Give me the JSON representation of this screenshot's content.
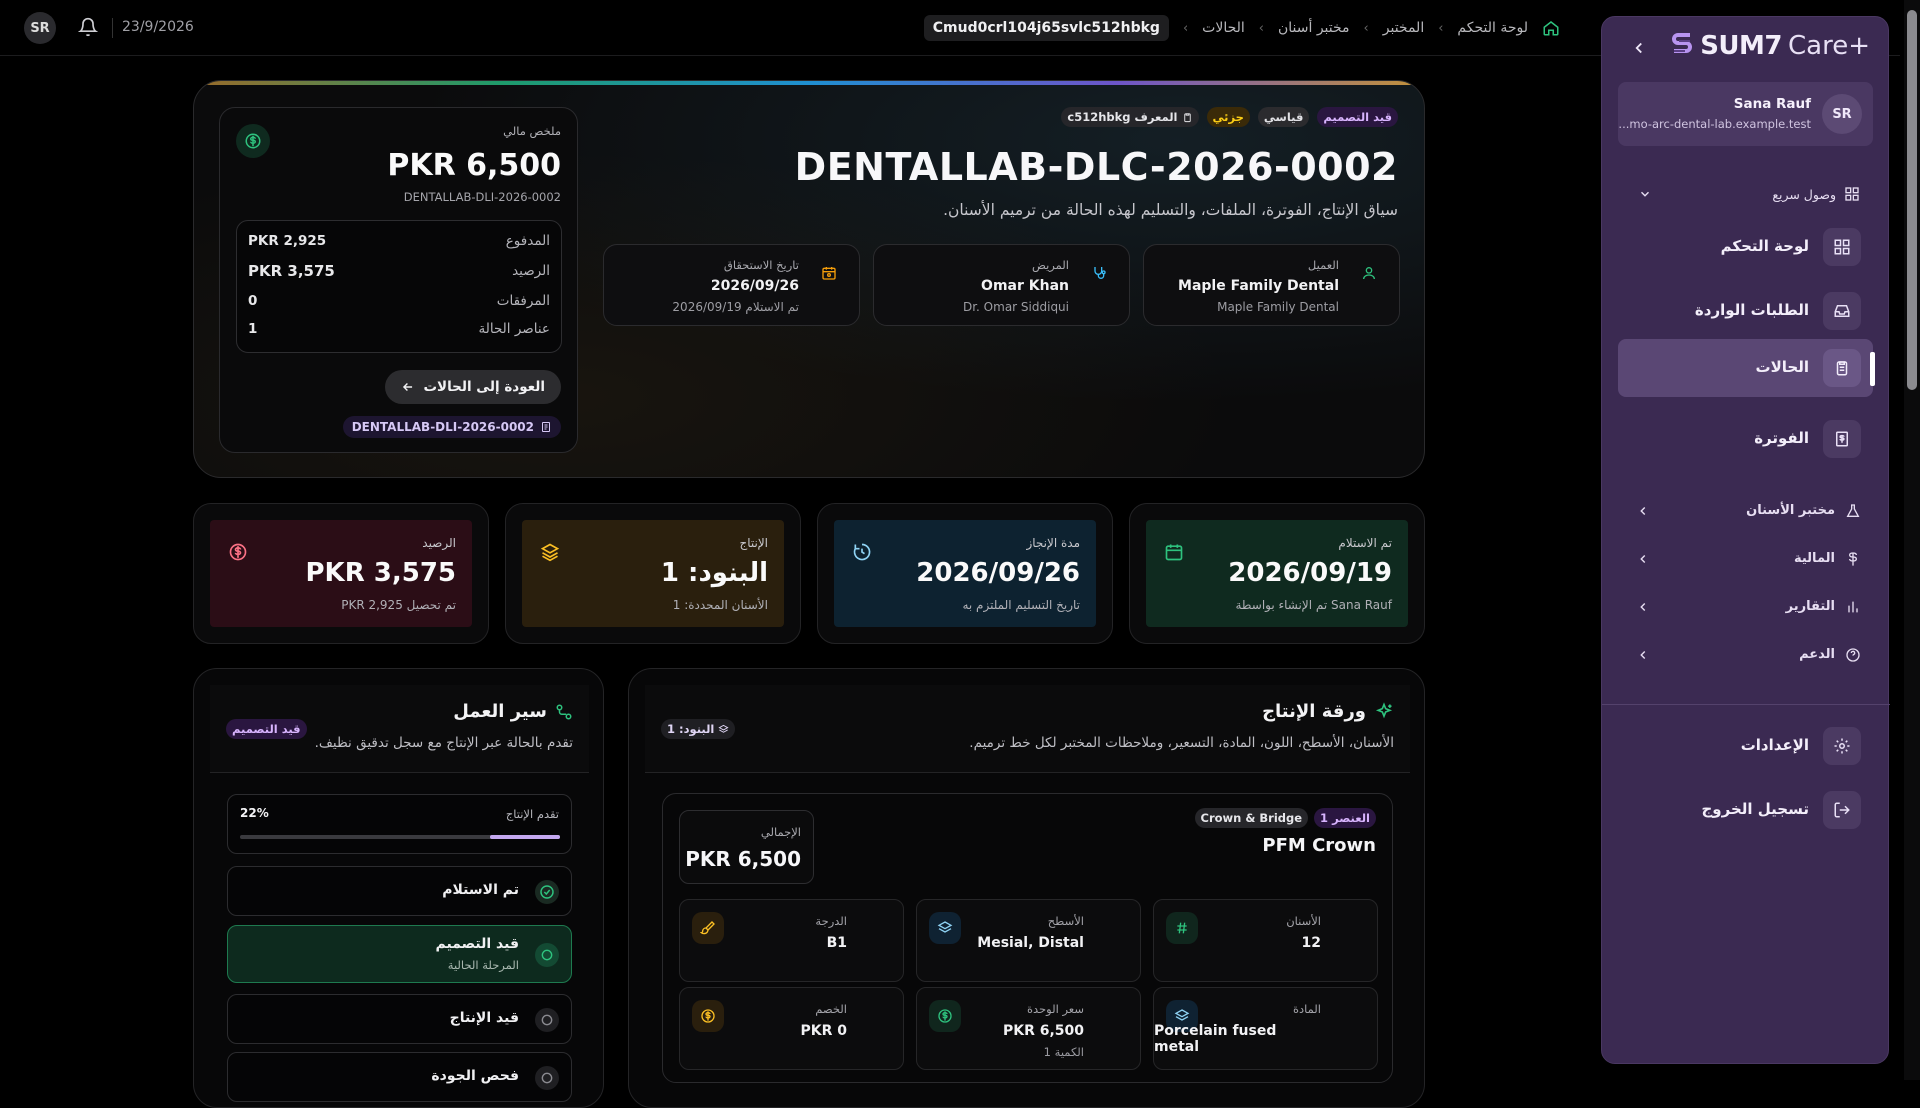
{
  "topbar": {
    "avatar": "SR",
    "date": "23/9/2026",
    "breadcrumbs": [
      "لوحة التحكم",
      "المختبر",
      "مختبر أسنان",
      "الحالات"
    ],
    "current_id": "Cmud0crl104j65svlc512hbkg"
  },
  "hero": {
    "badges": {
      "status": "قيد التصميم",
      "priority": "قياسي",
      "type": "جزئي",
      "id_label": "المعرف",
      "id_value": "c512hbkg"
    },
    "title": "DENTALLAB-DLC-2026-0002",
    "subtitle": "سياق الإنتاج، الفوترة، الملفات، والتسليم لهذه الحالة من ترميم الأسنان.",
    "client": {
      "label": "العميل",
      "value": "Maple Family Dental",
      "sub": "Maple Family Dental"
    },
    "patient": {
      "label": "المريض",
      "value": "Omar Khan",
      "sub": "Dr. Omar Siddiqui"
    },
    "due": {
      "label": "تاريخ الاستحقاق",
      "value": "2026/09/26",
      "sub": "تم الاستلام 2026/09/19"
    },
    "finance": {
      "label": "ملخص مالي",
      "total": "PKR 6,500",
      "invoice_ref": "DENTALLAB-DLI-2026-0002",
      "rows": [
        {
          "label": "المدفوع",
          "value": "PKR 2,925"
        },
        {
          "label": "الرصيد",
          "value": "PKR 3,575"
        },
        {
          "label": "المرفقات",
          "value": "0"
        },
        {
          "label": "عناصر الحالة",
          "value": "1"
        }
      ],
      "back_button": "العودة إلى الحالات",
      "invoice_link": "DENTALLAB-DLI-2026-0002"
    }
  },
  "stats": [
    {
      "label": "تم الاستلام",
      "value": "2026/09/19",
      "sub": "تم الإنشاء بواسطة Sana Rauf",
      "color": "#0f2a1f"
    },
    {
      "label": "مدة الإنجاز",
      "value": "2026/09/26",
      "sub": "تاريخ التسليم الملتزم به",
      "color": "#0d2230"
    },
    {
      "label": "الإنتاج",
      "value": "البنود: 1",
      "sub": "الأسنان المحددة: 1",
      "color": "#2a1f0d"
    },
    {
      "label": "الرصيد",
      "value": "PKR 3,575",
      "sub": "تم تحصيل PKR 2,925",
      "color": "#2b0d16"
    }
  ],
  "workflow": {
    "title": "سير العمل",
    "subtitle": "تقدم بالحالة عبر الإنتاج مع سجل تدقيق نظيف.",
    "badge": "قيد التصميم",
    "progress_label": "تقدم الإنتاج",
    "progress_value": "22%",
    "progress_fraction": 0.22,
    "steps": [
      {
        "title": "تم الاستلام",
        "sub": ""
      },
      {
        "title": "قيد التصميم",
        "sub": "المرحلة الحالية"
      },
      {
        "title": "قيد الإنتاج",
        "sub": ""
      },
      {
        "title": "فحص الجودة",
        "sub": ""
      }
    ]
  },
  "production": {
    "title": "ورقة الإنتاج",
    "subtitle": "الأسنان، الأسطح، اللون، المادة، التسعير، وملاحظات المختبر لكل خط ترميم.",
    "badge": "البنود: 1",
    "item": {
      "index_badge": "العنصر 1",
      "category": "Crown & Bridge",
      "name": "PFM Crown",
      "total_label": "الإجمالي",
      "total": "PKR 6,500",
      "fields": [
        {
          "label": "الأسنان",
          "value": "12",
          "sub": ""
        },
        {
          "label": "الأسطح",
          "value": "Mesial, Distal",
          "sub": ""
        },
        {
          "label": "الدرجة",
          "value": "B1",
          "sub": ""
        },
        {
          "label": "المادة",
          "value": "Porcelain fused metal",
          "sub": ""
        },
        {
          "label": "سعر الوحدة",
          "value": "PKR 6,500",
          "sub": "الكمية 1"
        },
        {
          "label": "الخصم",
          "value": "PKR 0",
          "sub": ""
        }
      ]
    }
  },
  "sidebar": {
    "brand": "SUM7",
    "brand_suffix": "Care+",
    "user_name": "Sana Rauf",
    "user_email": "...mo-arc-dental-lab.example.test",
    "user_initials": "SR",
    "quick_access": "وصول سريع",
    "main_items": [
      "لوحة التحكم",
      "الطلبات الواردة",
      "الحالات",
      "الفوترة"
    ],
    "groups": [
      "مختبر الأسنان",
      "المالية",
      "التقارير",
      "الدعم"
    ],
    "settings": "الإعدادات",
    "logout": "تسجيل الخروج"
  }
}
